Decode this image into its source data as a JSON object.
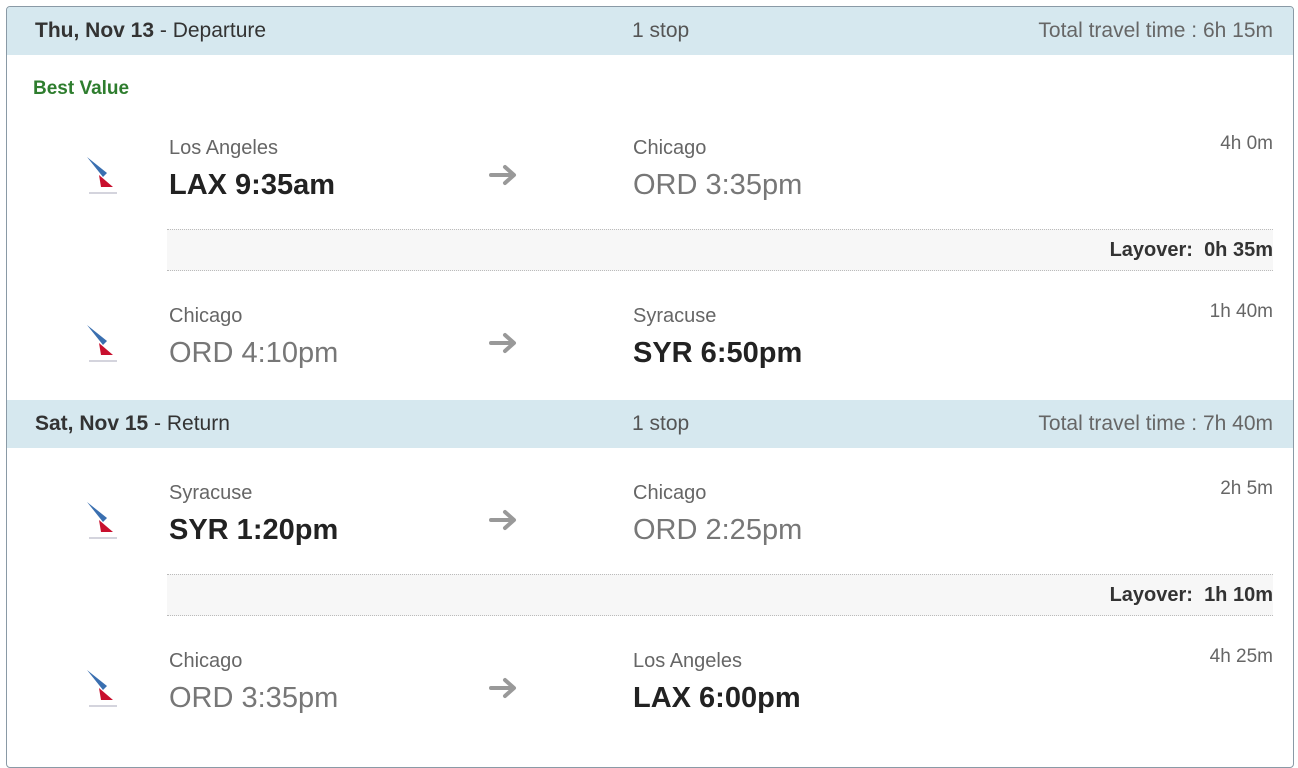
{
  "departure": {
    "date": "Thu, Nov 13",
    "direction": " - Departure",
    "stops": "1 stop",
    "total": "Total travel time : 6h 15m",
    "badge": "Best Value",
    "segments": [
      {
        "from_city": "Los Angeles",
        "from_time": "LAX 9:35am",
        "to_city": "Chicago",
        "to_time": "ORD 3:35pm",
        "duration": "4h 0m"
      },
      {
        "from_city": "Chicago",
        "from_time": "ORD 4:10pm",
        "to_city": "Syracuse",
        "to_time": "SYR 6:50pm",
        "duration": "1h 40m"
      }
    ],
    "layover_label": "Layover:",
    "layover_value": "0h 35m"
  },
  "return": {
    "date": "Sat, Nov 15",
    "direction": " - Return",
    "stops": "1 stop",
    "total": "Total travel time : 7h 40m",
    "segments": [
      {
        "from_city": "Syracuse",
        "from_time": "SYR 1:20pm",
        "to_city": "Chicago",
        "to_time": "ORD 2:25pm",
        "duration": "2h 5m"
      },
      {
        "from_city": "Chicago",
        "from_time": "ORD 3:35pm",
        "to_city": "Los Angeles",
        "to_time": "LAX 6:00pm",
        "duration": "4h 25m"
      }
    ],
    "layover_label": "Layover:",
    "layover_value": "1h 10m"
  },
  "icons": {
    "airline_logo": "american-airlines-logo-icon",
    "arrow": "arrow-right-icon"
  },
  "colors": {
    "header_bg": "#d6e8ef",
    "badge": "#2e7d2e",
    "card_border": "#8a9aa6"
  }
}
